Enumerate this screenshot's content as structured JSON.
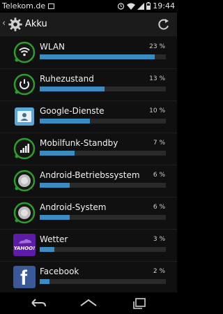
{
  "status_bar": {
    "carrier": "Telekom.de",
    "time": "19:44"
  },
  "header": {
    "title": "Akku"
  },
  "items": [
    {
      "label": "WLAN",
      "percent_text": "23 %",
      "value": 23,
      "icon": "wifi-icon"
    },
    {
      "label": "Ruhezustand",
      "percent_text": "13 %",
      "value": 13,
      "icon": "power-icon"
    },
    {
      "label": "Google-Dienste",
      "percent_text": "10 %",
      "value": 10,
      "icon": "google-services-icon"
    },
    {
      "label": "Mobilfunk-Standby",
      "percent_text": "7 %",
      "value": 7,
      "icon": "cell-signal-icon"
    },
    {
      "label": "Android-Betriebssystem",
      "percent_text": "6 %",
      "value": 6,
      "icon": "android-os-icon"
    },
    {
      "label": "Android-System",
      "percent_text": "6 %",
      "value": 6,
      "icon": "android-system-icon"
    },
    {
      "label": "Wetter",
      "percent_text": "3 %",
      "value": 3,
      "icon": "yahoo-weather-icon",
      "icon_text": "YAHOO!"
    },
    {
      "label": "Facebook",
      "percent_text": "2 %",
      "value": 2,
      "icon": "facebook-icon",
      "icon_text": "f"
    }
  ],
  "colors": {
    "bar": "#3a8cc3",
    "track": "#2a2a2a",
    "icon_ring": "#2e9d2e",
    "yahoo": "#5d1ca8",
    "facebook": "#3b5998"
  }
}
